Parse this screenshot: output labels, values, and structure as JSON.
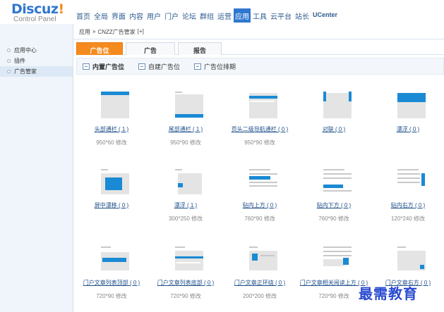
{
  "header": {
    "logo_main": "Discuz",
    "logo_bang": "!",
    "logo_sub": "Control Panel",
    "nav": [
      "首页",
      "全局",
      "界面",
      "内容",
      "用户",
      "门户",
      "论坛",
      "群组",
      "运营",
      "应用",
      "工具",
      "云平台",
      "站长",
      "UCenter"
    ],
    "active_nav": "应用"
  },
  "sidebar": {
    "items": [
      "应用中心",
      "插件",
      "广告管家"
    ],
    "active": "广告管家"
  },
  "breadcrumb": {
    "parts": [
      "应用",
      "»",
      "CNZZ广告管家",
      "[+]"
    ]
  },
  "tabs": [
    "广告位",
    "广告",
    "报告"
  ],
  "subtabs": [
    "内置广告位",
    "自建广告位",
    "广告位排期"
  ],
  "ads": [
    {
      "label": "头部通栏 ( 1 )",
      "size": "950*60 修改",
      "icon": "header-banner-icon"
    },
    {
      "label": "尾部通栏 ( 1 )",
      "size": "950*90 修改",
      "icon": "footer-banner-icon"
    },
    {
      "label": "页头二级导航通栏 ( 0 )",
      "size": "950*90 修改",
      "icon": "subnav-banner-icon"
    },
    {
      "label": "对联 ( 0 )",
      "size": "",
      "icon": "couplet-icon"
    },
    {
      "label": "漂浮 ( 0 )",
      "size": "",
      "icon": "float-icon"
    },
    {
      "label": "屏中漂移 ( 0 )",
      "size": "",
      "icon": "screen-center-icon"
    },
    {
      "label": "漂浮 ( 1 )",
      "size": "300*250 修改",
      "icon": "float-left-icon"
    },
    {
      "label": "贴内上方 ( 0 )",
      "size": "760*90 修改",
      "icon": "post-top-icon"
    },
    {
      "label": "贴内下方 ( 0 )",
      "size": "760*90 修改",
      "icon": "post-bottom-icon"
    },
    {
      "label": "贴内右方 ( 0 )",
      "size": "120*240 修改",
      "icon": "post-right-icon"
    },
    {
      "label": "门户文章列表顶部 ( 0 )",
      "size": "720*90 修改",
      "icon": "article-list-top-icon"
    },
    {
      "label": "门户文章列表底部 ( 0 )",
      "size": "720*90 修改",
      "icon": "article-list-bottom-icon"
    },
    {
      "label": "门户文章正环绕 ( 0 )",
      "size": "200*200 修改",
      "icon": "article-wrap-icon"
    },
    {
      "label": "门户文章相关阅读上方 ( 0 )",
      "size": "720*90 修改",
      "icon": "article-related-icon"
    },
    {
      "label": "门户文章右方 ( 0 )",
      "size": "",
      "icon": "article-right-icon"
    }
  ],
  "watermark": "最需教育",
  "colors": {
    "accent": "#2f77ce",
    "tab_active": "#f58a1f",
    "link": "#1d4f8a"
  }
}
